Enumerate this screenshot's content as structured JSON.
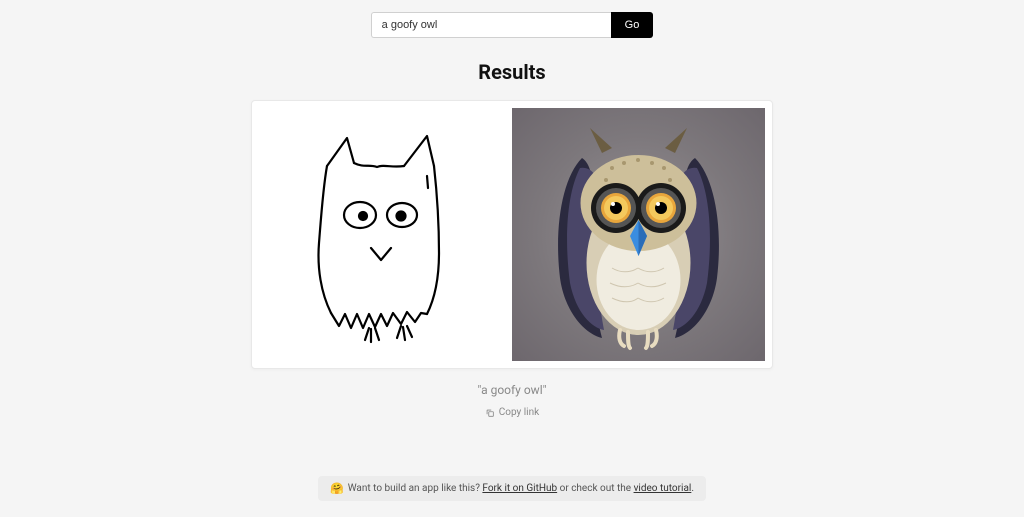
{
  "search": {
    "value": "a goofy owl",
    "button_label": "Go"
  },
  "results": {
    "title": "Results",
    "caption": "\"a goofy owl\"",
    "copy_link_label": "Copy link"
  },
  "footer": {
    "prefix": "Want to build an app like this? ",
    "fork_label": "Fork it on GitHub",
    "middle": " or check out the ",
    "tutorial_label": "video tutorial",
    "suffix": "."
  }
}
